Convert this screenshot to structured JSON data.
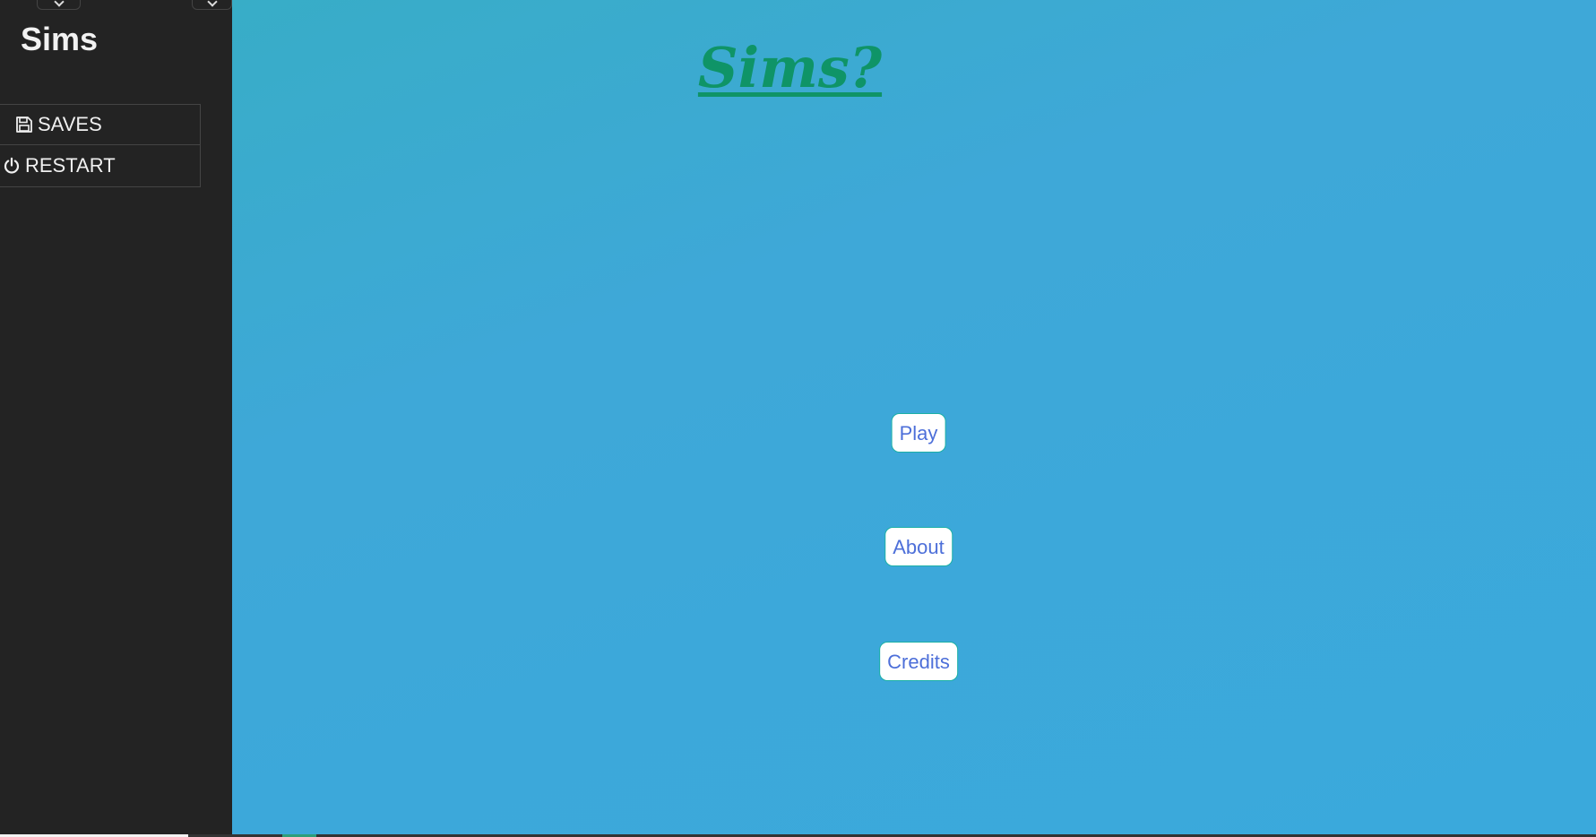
{
  "sidebar": {
    "story_title": "Sims",
    "menu": [
      {
        "label": "SAVES",
        "icon": "floppy-disk-icon"
      },
      {
        "label": "RESTART",
        "icon": "power-icon"
      }
    ]
  },
  "main": {
    "title": "Sims?",
    "buttons": [
      {
        "label": "Play"
      },
      {
        "label": "About"
      },
      {
        "label": "Credits"
      }
    ]
  },
  "colors": {
    "sidebar_bg": "#232323",
    "passage_bg": "#3aa9dc",
    "title": "#0f9467",
    "button_text": "#4d6fd9",
    "button_border": "#1bb0a6"
  }
}
